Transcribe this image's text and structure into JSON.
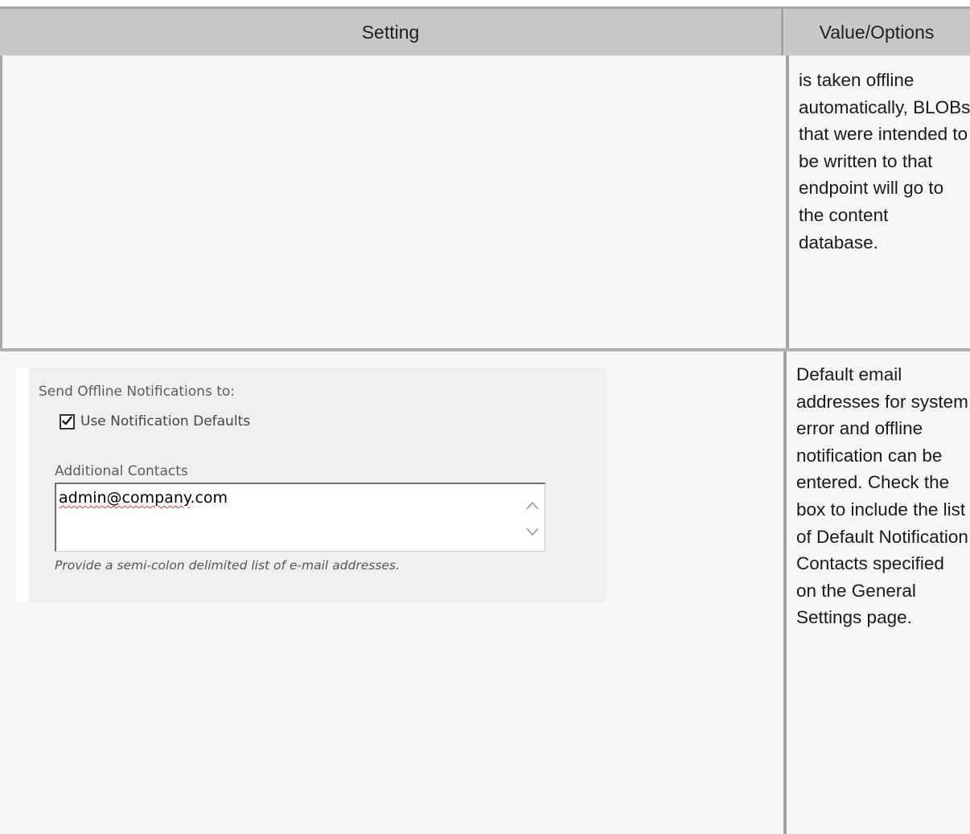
{
  "table": {
    "headers": {
      "setting": "Setting",
      "value": "Value/Options"
    },
    "rows": [
      {
        "value_text": "is taken offline automatically, BLOBs that were intended to be written to that endpoint will go to the content database."
      },
      {
        "form": {
          "section_label": "Send Offline Notifications to:",
          "use_defaults": {
            "label": "Use Notification Defaults",
            "checked": true
          },
          "contacts_label": "Additional Contacts",
          "contacts_value_prefix": "admin@company",
          "contacts_value_suffix": ".com",
          "hint": "Provide a semi-colon delimited list of e-mail addresses."
        },
        "value_text": "Default email addresses for system error and offline notification can be entered. Check the box to include the list of Default Notification Contacts specified on the General Settings page."
      }
    ]
  },
  "icons": {
    "checkbox_mark": "checkmark-icon",
    "scroll_up": "chevron-up-icon",
    "scroll_down": "chevron-down-icon"
  }
}
